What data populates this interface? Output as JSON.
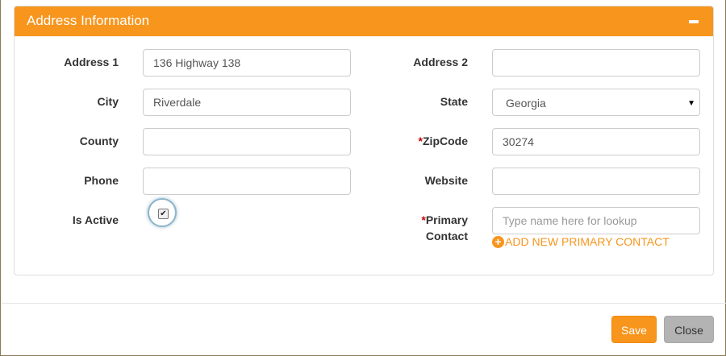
{
  "panel": {
    "title": "Address Information",
    "collapse_icon": "minus-icon"
  },
  "left_fields": {
    "address1": {
      "label": "Address 1",
      "value": "136 Highway 138"
    },
    "city": {
      "label": "City",
      "value": "Riverdale"
    },
    "county": {
      "label": "County",
      "value": ""
    },
    "phone": {
      "label": "Phone",
      "value": ""
    },
    "is_active": {
      "label": "Is Active",
      "checked": true,
      "check_glyph": "✔"
    }
  },
  "right_fields": {
    "address2": {
      "label": "Address 2",
      "value": ""
    },
    "state": {
      "label": "State",
      "value": "Georgia",
      "arrow": "▼"
    },
    "zipcode": {
      "required_mark": "*",
      "label": "ZipCode",
      "value": "30274"
    },
    "website": {
      "label": "Website",
      "value": ""
    },
    "primary_contact": {
      "required_mark": "*",
      "label_line1": "Primary",
      "label_line2": "Contact",
      "value": "",
      "placeholder": "Type name here for lookup"
    }
  },
  "add_contact": {
    "icon": "plus-circle-icon",
    "plus_glyph": "+",
    "label": "ADD NEW PRIMARY CONTACT"
  },
  "footer": {
    "save_label": "Save",
    "close_label": "Close"
  },
  "colors": {
    "accent": "#f7951d",
    "close_button": "#b3b3b3",
    "required": "#cc0000"
  }
}
